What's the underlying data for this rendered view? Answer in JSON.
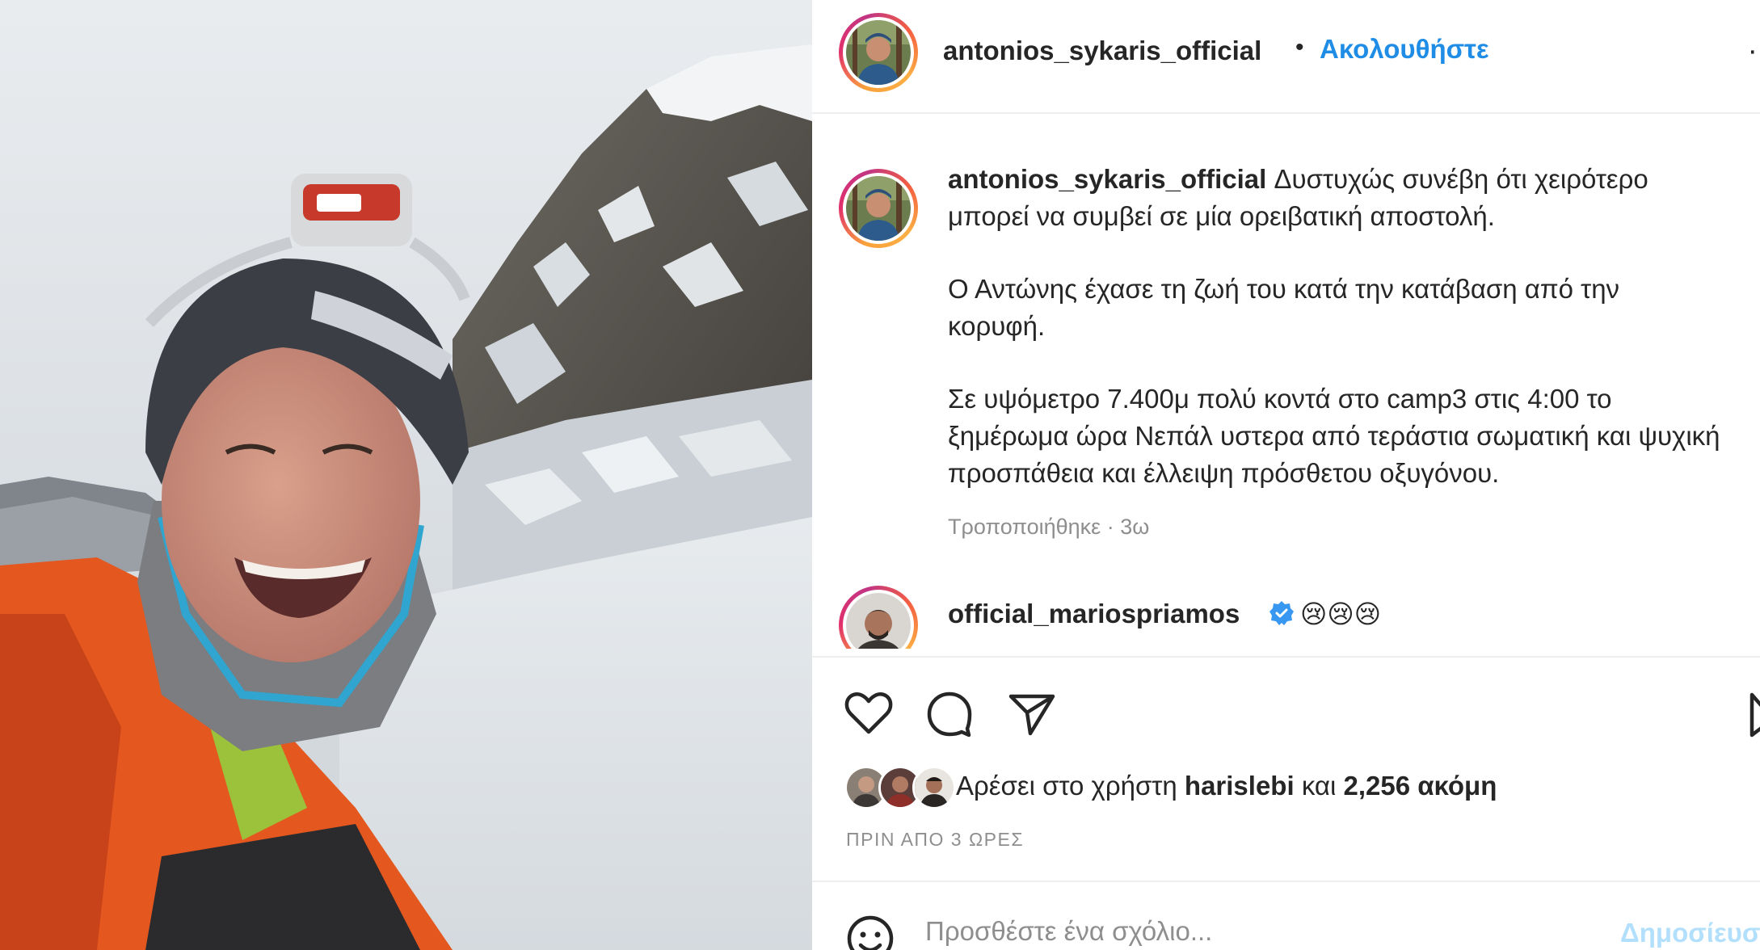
{
  "post": {
    "username": "antonios_sykaris_official",
    "separator": "•",
    "follow_label": "Ακολουθήστε",
    "more_icon": "more-dots-icon"
  },
  "caption": {
    "username": "antonios_sykaris_official",
    "paragraph1": "Δυστυχώς συνέβη ότι χειρότερο μπορεί να συμβεί σε μία ορειβατική αποστολή.",
    "paragraph2": "Ο Αντώνης έχασε τη ζωή του κατά την κατάβαση από την κορυφή.",
    "paragraph3": "Σε υψόμετρο 7.400μ πολύ κοντά στο camp3 στις 4:00 το ξημέρωμα ώρα Νεπάλ υστερα από τεράστια σωματική και ψυχική προσπάθεια και έλλειψη πρόσθετου οξυγόνου.",
    "edited_label": "Τροποποιήθηκε · 3ω"
  },
  "comment": {
    "username": "official_mariospriamos",
    "text": "😢😢😢"
  },
  "actions": {
    "icons": [
      "heart-icon",
      "comment-icon",
      "share-icon",
      "bookmark-icon"
    ]
  },
  "likes": {
    "prefix": "Αρέσει στο χρήστη",
    "user": "harislebi",
    "middle": "και",
    "count": "2,256 ακόμη"
  },
  "timestamp": "ΠΡΙΝ ΑΠΟ 3 ΩΡΕΣ",
  "add_comment": {
    "placeholder": "Προσθέστε ένα σχόλιο...",
    "post_label": "Δημοσίευση"
  },
  "colors": {
    "link_blue": "#1f8de6",
    "muted": "#8e8e8e",
    "verified": "#3897f0",
    "post_disabled": "#b2dffc"
  }
}
